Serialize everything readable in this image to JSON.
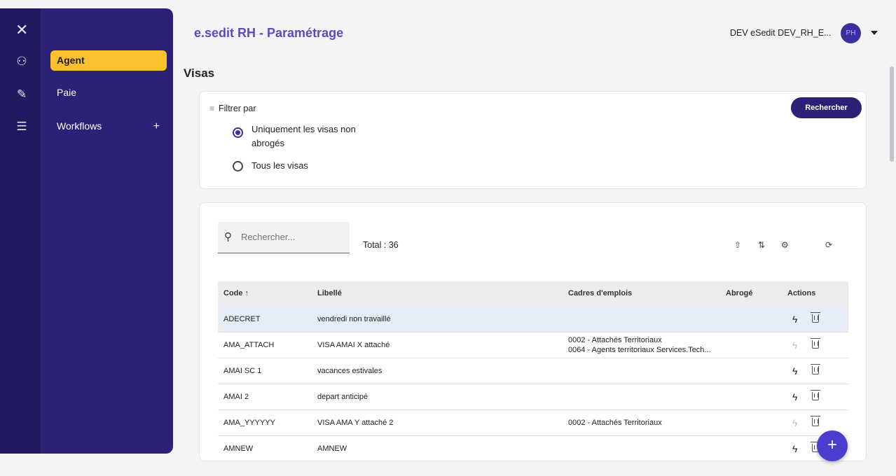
{
  "header": {
    "app_title": "e.sedit RH - Paramétrage",
    "user_name": "DEV eSedit DEV_RH_E...",
    "avatar_initials": "PH"
  },
  "sidebar": {
    "items": [
      {
        "label": "Agent",
        "active": true
      },
      {
        "label": "Paie",
        "active": false
      },
      {
        "label": "Workflows",
        "active": false,
        "expand": "+"
      }
    ]
  },
  "page": {
    "title": "Visas"
  },
  "filter": {
    "label": "Filtrer par",
    "search_button": "Rechercher",
    "options": [
      {
        "label": "Uniquement les visas non abrogés",
        "checked": true
      },
      {
        "label": "Tous les visas",
        "checked": false
      }
    ]
  },
  "table": {
    "search_placeholder": "Rechercher...",
    "total": "Total : 36",
    "columns": {
      "code": "Code ↑",
      "libelle": "Libellé",
      "cadres": "Cadres d'emplois",
      "abroge": "Abrogé",
      "actions": "Actions"
    },
    "rows": [
      {
        "code": "ADECRET",
        "libelle": "vendredi non travaillé",
        "cadres1": "",
        "cadres2": "",
        "active_action": true
      },
      {
        "code": "AMA_ATTACH",
        "libelle": "VISA AMAI X attaché",
        "cadres1": "0002 - Attachés Territoriaux",
        "cadres2": "0064 - Agents territoriaux Services.Tech...",
        "active_action": false
      },
      {
        "code": "AMAI SC 1",
        "libelle": "vacances estivales",
        "cadres1": "",
        "cadres2": "",
        "active_action": true
      },
      {
        "code": "AMAI 2",
        "libelle": "depart anticipé",
        "cadres1": "",
        "cadres2": "",
        "active_action": true
      },
      {
        "code": "AMA_YYYYYY",
        "libelle": "VISA AMA Y attaché 2",
        "cadres1": "0002 - Attachés Territoriaux",
        "cadres2": "",
        "active_action": false
      },
      {
        "code": "AMNEW",
        "libelle": "AMNEW",
        "cadres1": "",
        "cadres2": "",
        "active_action": true
      }
    ]
  },
  "colors": {
    "sidebar": "#2b2278",
    "active_item": "#fbc02d",
    "title": "#5a4cc0",
    "fab": "#4a3dcf"
  }
}
